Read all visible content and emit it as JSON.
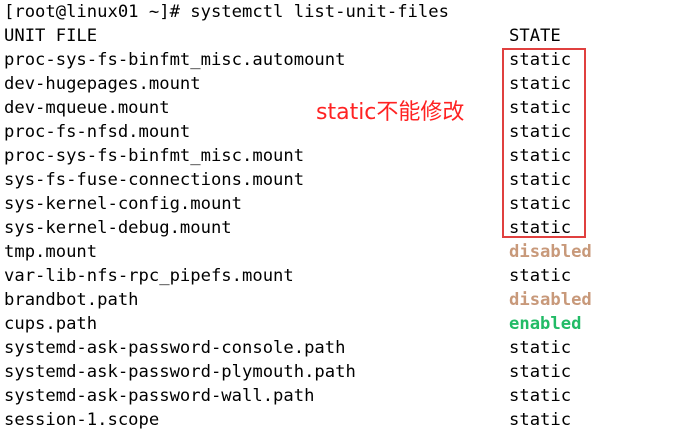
{
  "terminal": {
    "prompt_line": "[root@linux01 ~]# systemctl list-unit-files",
    "header": {
      "unit_label": "UNIT FILE",
      "state_label": "STATE"
    },
    "rows": [
      {
        "unit": "proc-sys-fs-binfmt_misc.automount",
        "state": "static",
        "kind": "static"
      },
      {
        "unit": "dev-hugepages.mount",
        "state": "static",
        "kind": "static"
      },
      {
        "unit": "dev-mqueue.mount",
        "state": "static",
        "kind": "static"
      },
      {
        "unit": "proc-fs-nfsd.mount",
        "state": "static",
        "kind": "static"
      },
      {
        "unit": "proc-sys-fs-binfmt_misc.mount",
        "state": "static",
        "kind": "static"
      },
      {
        "unit": "sys-fs-fuse-connections.mount",
        "state": "static",
        "kind": "static"
      },
      {
        "unit": "sys-kernel-config.mount",
        "state": "static",
        "kind": "static"
      },
      {
        "unit": "sys-kernel-debug.mount",
        "state": "static",
        "kind": "static"
      },
      {
        "unit": "tmp.mount",
        "state": "disabled",
        "kind": "disabled"
      },
      {
        "unit": "var-lib-nfs-rpc_pipefs.mount",
        "state": "static",
        "kind": "static"
      },
      {
        "unit": "brandbot.path",
        "state": "disabled",
        "kind": "disabled"
      },
      {
        "unit": "cups.path",
        "state": "enabled",
        "kind": "enabled"
      },
      {
        "unit": "systemd-ask-password-console.path",
        "state": "static",
        "kind": "static"
      },
      {
        "unit": "systemd-ask-password-plymouth.path",
        "state": "static",
        "kind": "static"
      },
      {
        "unit": "systemd-ask-password-wall.path",
        "state": "static",
        "kind": "static"
      },
      {
        "unit": "session-1.scope",
        "state": "static",
        "kind": "static"
      }
    ]
  },
  "annotation": {
    "text": "static不能修改",
    "color": "#ff2222",
    "box_color": "#e0403f"
  },
  "colors": {
    "background": "#ffffff",
    "text": "#000000",
    "disabled": "#c8997a",
    "enabled": "#22bb66"
  }
}
